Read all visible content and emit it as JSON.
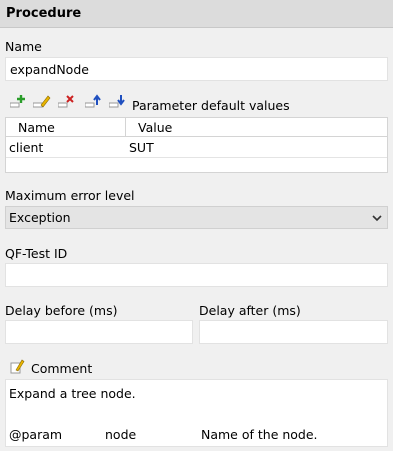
{
  "header": {
    "title": "Procedure"
  },
  "name": {
    "label": "Name",
    "value": "expandNode"
  },
  "params": {
    "title": "Parameter default values",
    "columns": [
      "Name",
      "Value"
    ],
    "rows": [
      {
        "name": "client",
        "value": "SUT"
      }
    ],
    "toolbar_icons": [
      "add-icon",
      "edit-icon",
      "delete-icon",
      "move-up-icon",
      "move-down-icon"
    ]
  },
  "error_level": {
    "label": "Maximum error level",
    "value": "Exception"
  },
  "qftest_id": {
    "label": "QF-Test ID",
    "value": ""
  },
  "delay_before": {
    "label": "Delay before (ms)",
    "value": ""
  },
  "delay_after": {
    "label": "Delay after (ms)",
    "value": ""
  },
  "comment": {
    "label": "Comment",
    "line1": "Expand a tree node.",
    "param_tag": "@param",
    "param_name": "node",
    "param_desc": "Name of the node."
  },
  "colors": {
    "header_bg": "#dcdcdc",
    "panel_bg": "#f0f0f0",
    "add_green": "#2a9d2a",
    "delete_red": "#cc2222",
    "arrow_blue": "#1f4fbf",
    "pencil_yellow": "#e8b400"
  }
}
